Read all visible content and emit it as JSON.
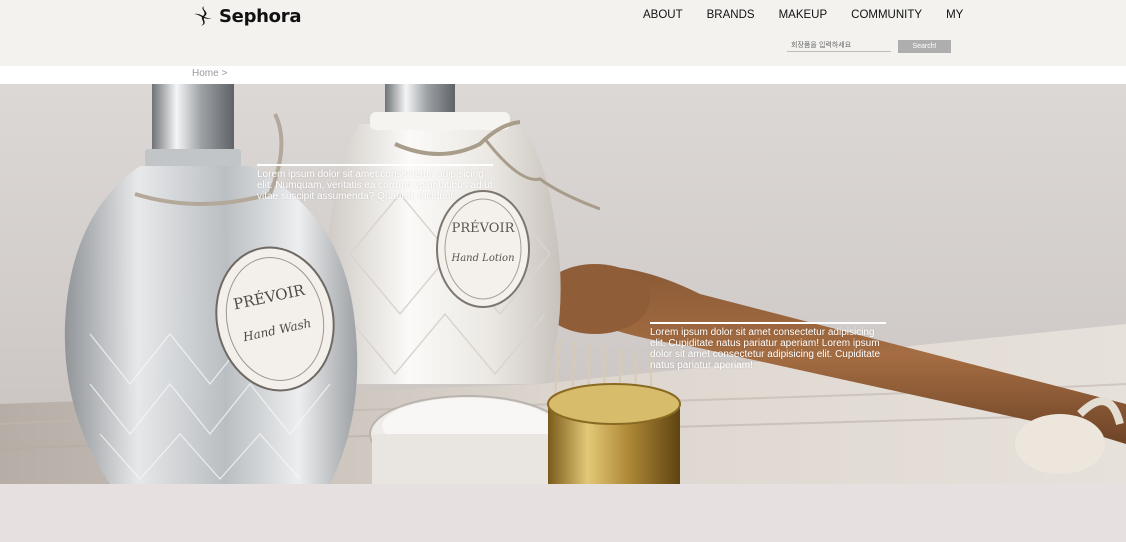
{
  "brand": {
    "name": "Sephora",
    "icon": "sephora-flame-icon"
  },
  "nav": {
    "items": [
      {
        "label": "ABOUT"
      },
      {
        "label": "BRANDS"
      },
      {
        "label": "MAKEUP"
      },
      {
        "label": "COMMUNITY"
      },
      {
        "label": "MY"
      }
    ]
  },
  "search": {
    "placeholder": "회장품을 입력하세요",
    "button_label": "Search!"
  },
  "breadcrumb": {
    "label": "Home >"
  },
  "hero": {
    "text1": "Lorem ipsum dolor sit amet consectetur, adipisicing elit. Numquam, veritatis ea corrupti voluptatibus ad ut vitae suscipit assumenda? Quaerat, incidunt.",
    "text2": "Lorem ipsum dolor sit amet consectetur adipisicing elit. Cupiditate natus pariatur aperiam! Lorem ipsum dolor sit amet consectetur adipisicing elit. Cupiditate natus pariatur aperiam!",
    "label_brand": "PRÉVOIR",
    "label_wash": "Hand Wash",
    "label_lotion": "Hand Lotion"
  },
  "colors": {
    "header_bg": "#f3f2ee",
    "body_bg": "#e6e1e0",
    "button_bg": "#aeaeae",
    "text_dark": "#111111"
  }
}
